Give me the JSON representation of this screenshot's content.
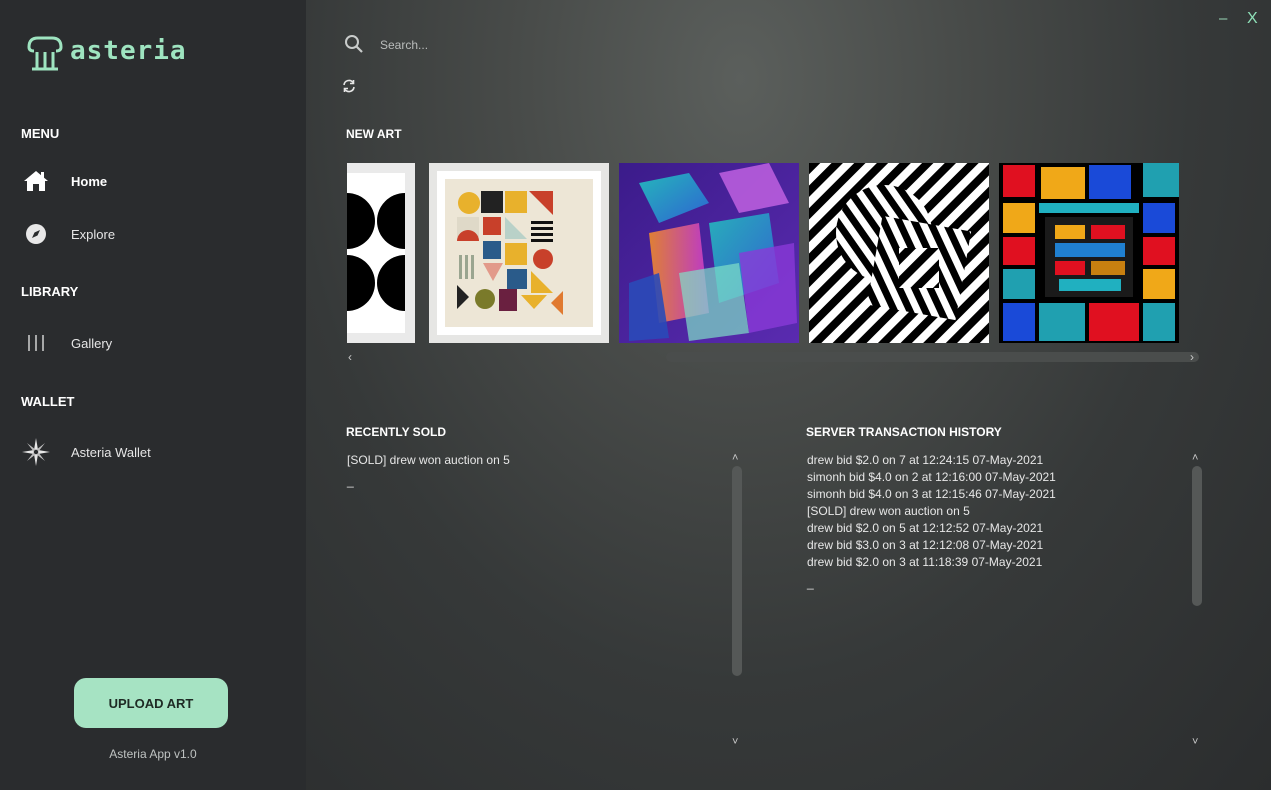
{
  "app": {
    "logo_text": "asteria",
    "version": "Asteria App v1.0"
  },
  "window": {
    "minimize": "–",
    "close": "X"
  },
  "sidebar": {
    "menu_title": "MENU",
    "library_title": "LIBRARY",
    "wallet_title": "WALLET",
    "items": [
      {
        "label": "Home",
        "icon": "home-icon",
        "active": true
      },
      {
        "label": "Explore",
        "icon": "compass-icon"
      },
      {
        "label": "Gallery",
        "icon": "gallery-icon"
      },
      {
        "label": "Asteria Wallet",
        "icon": "wallet-star-icon"
      }
    ],
    "upload_label": "UPLOAD ART"
  },
  "search": {
    "placeholder": "Search..."
  },
  "new_art": {
    "title": "NEW ART"
  },
  "recently_sold": {
    "title": "RECENTLY SOLD",
    "lines": [
      "[SOLD] drew won auction on 5",
      "_"
    ]
  },
  "history": {
    "title": "SERVER TRANSACTION HISTORY",
    "lines": [
      "drew bid $2.0 on 7 at 12:24:15 07-May-2021",
      "simonh bid $4.0 on 2 at 12:16:00 07-May-2021",
      "simonh bid $4.0 on 3 at 12:15:46 07-May-2021",
      "[SOLD] drew won auction on 5",
      "drew bid $2.0 on 5 at 12:12:52 07-May-2021",
      "drew bid $3.0 on 3 at 12:12:08 07-May-2021",
      "drew bid $2.0 on 3 at 11:18:39 07-May-2021",
      "_"
    ]
  },
  "colors": {
    "accent": "#a6e3c3",
    "sidebar": "#2a2c2e",
    "logo": "#9ee4c0"
  }
}
